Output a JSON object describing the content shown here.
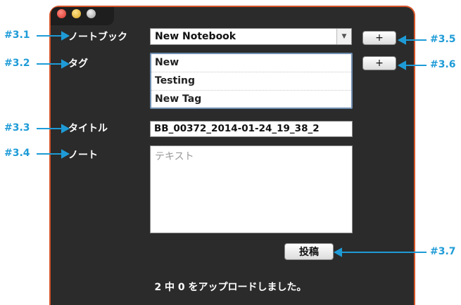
{
  "form": {
    "notebook_label": "ノートブック",
    "tag_label": "タグ",
    "title_label": "タイトル",
    "note_label": "ノート",
    "notebook_value": "New Notebook",
    "tags": [
      "New",
      "Testing",
      "New Tag"
    ],
    "title_value": "BB_00372_2014-01-24_19_38_2",
    "note_placeholder": "テキスト",
    "add_notebook_label": "+",
    "add_tag_label": "+",
    "post_label": "投稿"
  },
  "status": {
    "text": "2 中 0 をアップロードしました。"
  },
  "callouts": {
    "c31": "#3.1",
    "c32": "#3.2",
    "c33": "#3.3",
    "c34": "#3.4",
    "c35": "#3.5",
    "c36": "#3.6",
    "c37": "#3.7"
  },
  "colors": {
    "panel": "#2b2b2b",
    "panel_border": "#d4552a",
    "callout": "#1e9bd7"
  }
}
